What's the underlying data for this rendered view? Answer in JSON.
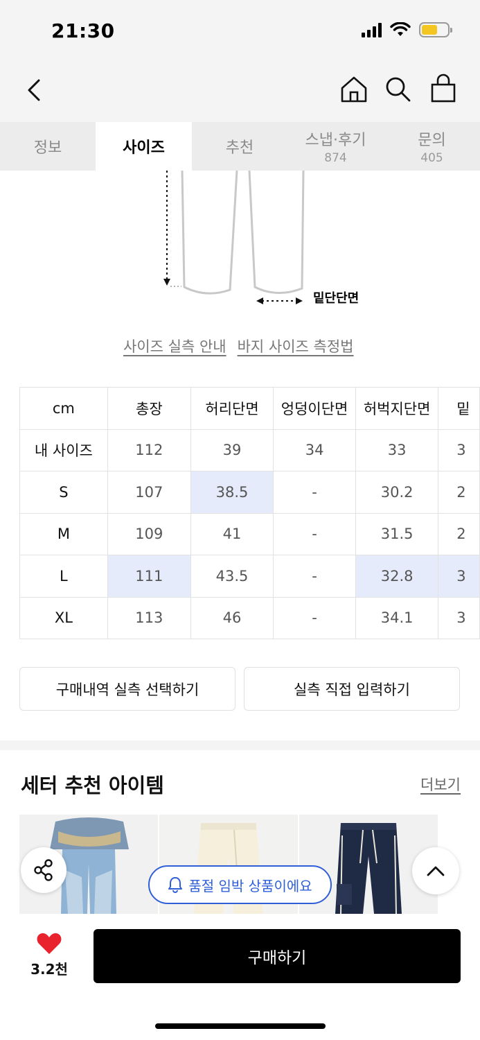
{
  "status": {
    "time": "21:30"
  },
  "nav": {
    "icons": [
      "back-icon",
      "home-icon",
      "search-icon",
      "bag-icon"
    ]
  },
  "tabs": [
    {
      "label": "정보",
      "count": ""
    },
    {
      "label": "사이즈",
      "count": "",
      "active": true
    },
    {
      "label": "추천",
      "count": ""
    },
    {
      "label": "스냅·후기",
      "count": "874"
    },
    {
      "label": "문의",
      "count": "405"
    }
  ],
  "diagram": {
    "hem_label": "밑단단면"
  },
  "size_links": {
    "guide": "사이즈 실측 안내",
    "how_to": "바지 사이즈 측정법"
  },
  "size_table": {
    "headers": [
      "cm",
      "총장",
      "허리단면",
      "엉덩이단면",
      "허벅지단면",
      "밑"
    ],
    "rows": [
      {
        "label": "내 사이즈",
        "values": [
          "112",
          "39",
          "34",
          "33",
          "3"
        ]
      },
      {
        "label": "S",
        "values": [
          "107",
          "38.5",
          "-",
          "30.2",
          "2"
        ]
      },
      {
        "label": "M",
        "values": [
          "109",
          "41",
          "-",
          "31.5",
          "2"
        ]
      },
      {
        "label": "L",
        "values": [
          "111",
          "43.5",
          "-",
          "32.8",
          "3"
        ]
      },
      {
        "label": "XL",
        "values": [
          "113",
          "46",
          "-",
          "34.1",
          "3"
        ]
      }
    ]
  },
  "actions": {
    "select_history": "구매내역 실측 선택하기",
    "manual_input": "실측 직접 입력하기"
  },
  "recommend": {
    "title": "세터 추천 아이템",
    "more": "더보기"
  },
  "soldout_notice": "품절 임박 상품이에요",
  "bottom": {
    "like_count": "3.2천",
    "buy": "구매하기"
  },
  "colors": {
    "accent": "#2f5fd8",
    "highlight": "#e6ebfb",
    "like": "#e8232e"
  }
}
